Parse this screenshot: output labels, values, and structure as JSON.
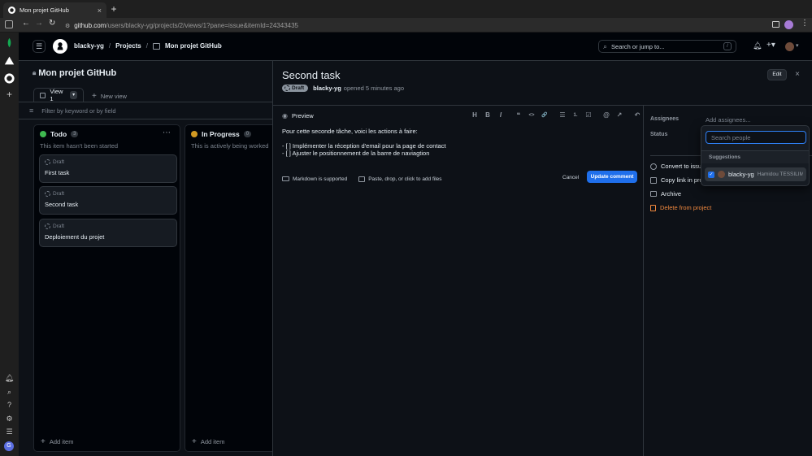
{
  "browser": {
    "tab_title": "Mon projet GitHub",
    "new_tab": "+",
    "url_host": "github.com",
    "url_path": "/users/blacky-yg/projects/2/views/1?pane=issue&itemId=24343435"
  },
  "header": {
    "breadcrumbs": [
      "blacky-yg",
      "Projects",
      "Mon projet GitHub"
    ],
    "search_placeholder": "Search or jump to...",
    "search_key": "/"
  },
  "board": {
    "project_title": "Mon projet GitHub",
    "view_tab": "View 1",
    "new_view": "New view",
    "filter_placeholder": "Filter by keyword or by field",
    "columns": [
      {
        "name": "Todo",
        "count": "3",
        "color": "#3fb950",
        "description": "This item hasn't been started",
        "cards": [
          {
            "status": "Draft",
            "title": "First task"
          },
          {
            "status": "Draft",
            "title": "Second task"
          },
          {
            "status": "Draft",
            "title": "Deploiement du projet"
          }
        ],
        "add_item": "Add item"
      },
      {
        "name": "In Progress",
        "count": "0",
        "color": "#d29922",
        "description": "This is actively being worked",
        "add_item": "Add item"
      }
    ]
  },
  "panel": {
    "title": "Second task",
    "badge": "Draft",
    "author": "blacky-yg",
    "opened": "opened 5 minutes ago",
    "edit_label": "Edit",
    "close_label": "×",
    "preview_tab": "Preview",
    "toolbar": [
      "H",
      "B",
      "I",
      "❝",
      "<>",
      "🔗",
      "☰",
      "1.",
      "☑",
      "@",
      "↗",
      "↶"
    ],
    "body_lines": [
      "Pour cette seconde tâche, voici les actions à faire:",
      "",
      "- [ ] Implémenter la réception d'email pour la page de contact",
      "- [ ] Ajuster le positionnement de la barre de naviagtion"
    ],
    "markdown_note": "Markdown is supported",
    "files_note": "Paste, drop, or click to add files",
    "cancel_label": "Cancel",
    "update_label": "Update comment",
    "assignees_label": "Assignees",
    "assignees_placeholder": "Add assignees...",
    "status_label": "Status",
    "actions": [
      "Convert to issue",
      "Copy link in project",
      "Archive",
      "Delete from project"
    ]
  },
  "dropdown": {
    "search_placeholder": "Search people",
    "suggestions_label": "Suggestions",
    "user": {
      "login": "blacky-yg",
      "name": "Hamidou TESSILIMI"
    }
  },
  "colors": {
    "accent": "#1f6feb",
    "danger": "#f0883e"
  }
}
